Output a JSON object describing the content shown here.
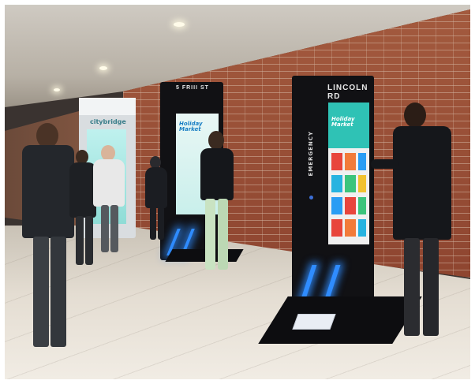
{
  "kiosks": {
    "front": {
      "header": "LINCOLN RD",
      "side_label": "EMERGENCY",
      "screen_title": "Holiday Market"
    },
    "middle": {
      "header": "5 FRIII ST",
      "screen_title": "Holiday Market"
    },
    "far": {
      "brand": "citybridge"
    }
  },
  "colors": {
    "brick": "#9e4f35",
    "kiosk_body": "#111114",
    "screen_teal": "#2fc2b5",
    "accent_glow": "#2f8cff"
  }
}
